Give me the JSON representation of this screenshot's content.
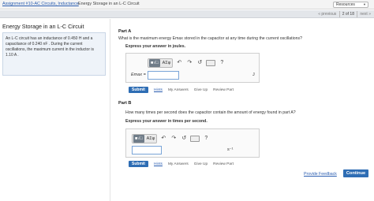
{
  "topbar": {
    "assignment_link": "Assignment #10-AC Circuits, Inductance",
    "problem_title": "Energy Storage in an L-C Circuit",
    "resources_label": "Resources"
  },
  "pager": {
    "previous": "« previous",
    "current": "2 of 18",
    "next": "next »"
  },
  "problem": {
    "title": "Energy Storage in an L-C Circuit",
    "description": "An L-C circuit has an inductance of 0.450 H and a capacitance of 0.240 nF . During the current oscillations, the maximum current in the inductor is 1.10 A ."
  },
  "part_a": {
    "label": "Part A",
    "question": "What is the maximum energy Emax stored in the capacitor at any time during the current oscillations?",
    "instruction": "Express your answer in joules.",
    "variable": "Emax =",
    "unit": "J",
    "value": ""
  },
  "part_b": {
    "label": "Part B",
    "question": "How many times per second does the capacitor contain the amount of energy found in part A?",
    "instruction": "Express your answer in times per second.",
    "unit": "s⁻¹",
    "value": ""
  },
  "toolbar": {
    "template_label": "■√□",
    "symbols_label": "ΑΣφ",
    "help_label": "?"
  },
  "actions": {
    "submit": "Submit",
    "hints": "Hints",
    "my_answers": "My Answers",
    "give_up": "Give Up",
    "review_part": "Review Part"
  },
  "footer": {
    "feedback": "Provide Feedback",
    "continue": "Continue"
  },
  "colors": {
    "accent": "#2e6db4",
    "link": "#2a5db0",
    "problem_box": "#eef3f9"
  }
}
